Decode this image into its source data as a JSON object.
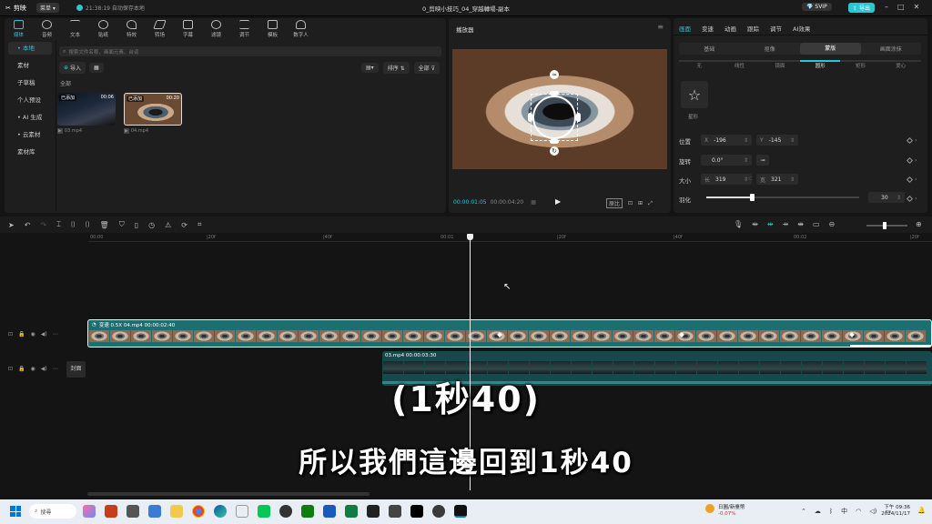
{
  "app": {
    "name": "剪映",
    "menu": "菜单",
    "autosave": "21:38:19 自动保存本地",
    "project_title": "0_剪映小技巧_04_穿越轉場-副本",
    "vip": "SVIP",
    "export": "导出"
  },
  "toolbar": {
    "items": [
      "媒体",
      "音频",
      "文本",
      "贴纸",
      "特效",
      "转场",
      "字幕",
      "滤镜",
      "调节",
      "模板",
      "数字人"
    ],
    "active_index": 0
  },
  "media": {
    "sidebar": [
      "• 本地",
      "素材",
      "子草稿",
      "个人预设",
      "• AI 生成",
      "• 云素材",
      "素材库"
    ],
    "search_placeholder": "搜索文件名称、画面元素、台词",
    "import_label": "导入",
    "sort_label": "排序",
    "filter_label": "全部",
    "section_label": "全部",
    "clips": [
      {
        "tag": "已添加",
        "duration": "00:06",
        "filename": "03.mp4"
      },
      {
        "tag": "已添加",
        "duration": "00:20",
        "filename": "04.mp4"
      }
    ]
  },
  "player": {
    "title": "播放器",
    "current_time": "00:00:01:05",
    "total_time": "00:00:04:20",
    "ratio_label": "原比"
  },
  "inspector": {
    "tabs": [
      "画面",
      "变速",
      "动画",
      "跟踪",
      "调节",
      "AI效果"
    ],
    "active_tab": 0,
    "subtabs": [
      "基础",
      "抠像",
      "蒙版",
      "画面涂抹"
    ],
    "active_subtab": 2,
    "mask_types": [
      "无",
      "线性",
      "镜面",
      "圆形",
      "矩形",
      "爱心"
    ],
    "shape_label": "星形",
    "position_label": "位置",
    "pos_x_label": "X",
    "pos_x": "-196",
    "pos_y_label": "Y",
    "pos_y": "-145",
    "rotate_label": "旋转",
    "rotate": "0.0°",
    "size_label": "大小",
    "width_label": "长",
    "width": "319",
    "height_label": "宽",
    "height": "321",
    "feather_label": "羽化",
    "feather": "30",
    "feather_fraction": 0.3
  },
  "timeline": {
    "ruler": [
      "00:00",
      "|20f",
      "|40f",
      "00:01",
      "|20f",
      "|40f",
      "00:02",
      "|20f"
    ],
    "main_clip_label": "变速 0.5X  04.mp4  00:00:02:40",
    "second_clip_label": "03.mp4  00:00:03:30",
    "cover_label": "封面"
  },
  "subtitles": {
    "line1": "(1秒40)",
    "line2": "所以我們這邊回到1秒40"
  },
  "taskbar": {
    "search_placeholder": "搜尋",
    "stock_name": "日圓/新臺幣",
    "stock_change": "-0.07%",
    "time": "下午 09:36",
    "date": "2024/11/17"
  },
  "colors": {
    "accent": "#2bc6d4",
    "clip_main": "#1d6f6f",
    "clip_second": "#16494c"
  }
}
